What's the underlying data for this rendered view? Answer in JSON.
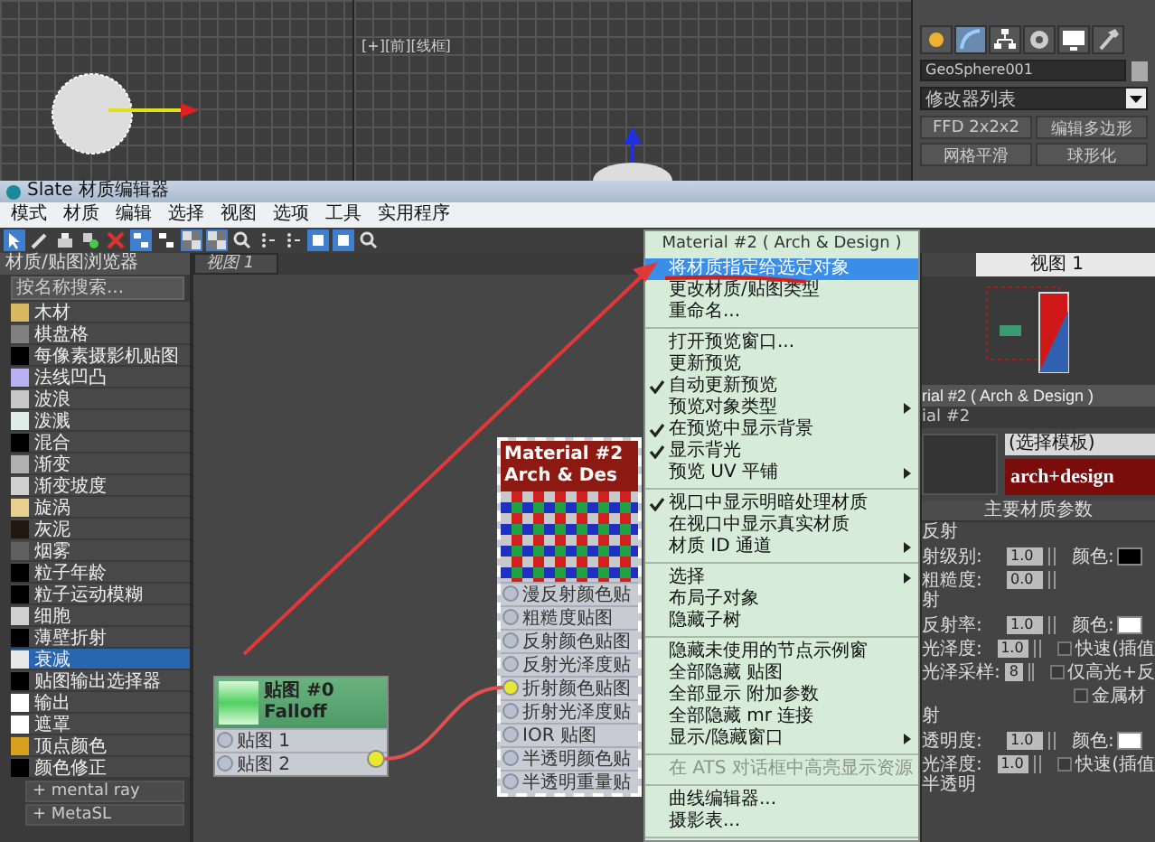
{
  "viewport": {
    "label": "[+][前][线框]"
  },
  "command_panel": {
    "tabs": [
      {
        "kind": "sun",
        "selected": false
      },
      {
        "kind": "curve",
        "selected": true
      },
      {
        "kind": "hierarchy",
        "selected": false
      },
      {
        "kind": "disc",
        "selected": false
      },
      {
        "kind": "monitor",
        "selected": false
      },
      {
        "kind": "hammer",
        "selected": false
      }
    ],
    "object_name": "GeoSphere001",
    "modifier_list": "修改器列表",
    "buttons": [
      "FFD 2x2x2",
      "编辑多边形",
      "网格平滑",
      "球形化"
    ]
  },
  "editor": {
    "title": "Slate 材质编辑器",
    "menu": [
      "模式",
      "材质",
      "编辑",
      "选择",
      "视图",
      "选项",
      "工具",
      "实用程序"
    ],
    "toolbar": [
      {
        "kind": "arrow",
        "selected": true
      },
      {
        "kind": "pen",
        "selected": false
      },
      {
        "kind": "put",
        "selected": false
      },
      {
        "kind": "assign",
        "selected": false
      },
      {
        "kind": "delete",
        "selected": false
      },
      {
        "kind": "layout",
        "selected": true
      },
      {
        "kind": "layout",
        "selected": false
      },
      {
        "kind": "checker",
        "selected": true
      },
      {
        "kind": "checker",
        "selected": true
      },
      {
        "kind": "zoom",
        "selected": false
      },
      {
        "kind": "dots",
        "selected": false
      },
      {
        "kind": "dots",
        "selected": false
      },
      {
        "kind": "square",
        "selected": true
      },
      {
        "kind": "square",
        "selected": true
      },
      {
        "kind": "zoom",
        "selected": false
      }
    ]
  },
  "browser": {
    "title": "材质/贴图浏览器",
    "placeholder": "按名称搜索...",
    "items": [
      {
        "label": "木材",
        "color": "#d8b860",
        "selected": false
      },
      {
        "label": "棋盘格",
        "color": "#808080",
        "selected": false
      },
      {
        "label": "每像素摄影机贴图",
        "color": "#000000",
        "selected": false
      },
      {
        "label": "法线凹凸",
        "color": "#b8b0f0",
        "selected": false
      },
      {
        "label": "波浪",
        "color": "#c8c8c8",
        "selected": false
      },
      {
        "label": "泼溅",
        "color": "#e0ece8",
        "selected": false
      },
      {
        "label": "混合",
        "color": "#000000",
        "selected": false
      },
      {
        "label": "渐变",
        "color": "#b0b0b0",
        "selected": false
      },
      {
        "label": "渐变坡度",
        "color": "#d0d0d0",
        "selected": false
      },
      {
        "label": "旋涡",
        "color": "#e8d090",
        "selected": false
      },
      {
        "label": "灰泥",
        "color": "#201810",
        "selected": false
      },
      {
        "label": "烟雾",
        "color": "#606060",
        "selected": false
      },
      {
        "label": "粒子年龄",
        "color": "#000000",
        "selected": false
      },
      {
        "label": "粒子运动模糊",
        "color": "#000000",
        "selected": false
      },
      {
        "label": "细胞",
        "color": "#d0d0d0",
        "selected": false
      },
      {
        "label": "薄壁折射",
        "color": "#000000",
        "selected": false
      },
      {
        "label": "衰减",
        "color": "#e8e8e8",
        "selected": true
      },
      {
        "label": "贴图输出选择器",
        "color": "#000000",
        "selected": false
      },
      {
        "label": "输出",
        "color": "#ffffff",
        "selected": false
      },
      {
        "label": "遮罩",
        "color": "#ffffff",
        "selected": false
      },
      {
        "label": "顶点颜色",
        "color": "#d8a020",
        "selected": false
      },
      {
        "label": "颜色修正",
        "color": "#000000",
        "selected": false
      }
    ],
    "groups": [
      "+ mental ray",
      "+ MetaSL"
    ]
  },
  "view_tab": "视图 1",
  "nodes": [
    {
      "kind": "map",
      "title": "贴图 #0",
      "subtitle": "Falloff",
      "selected": false,
      "slots": [
        {
          "label": "贴图 1",
          "connected": false
        },
        {
          "label": "贴图 2",
          "connected": false
        }
      ]
    },
    {
      "kind": "material",
      "title": "Material #2",
      "subtitle": "Arch & Des",
      "selected": true,
      "slots": [
        {
          "label": "漫反射颜色贴",
          "connected": false
        },
        {
          "label": "粗糙度贴图",
          "connected": false
        },
        {
          "label": "反射颜色贴图",
          "connected": false
        },
        {
          "label": "反射光泽度贴",
          "connected": false
        },
        {
          "label": "折射颜色贴图",
          "connected": true
        },
        {
          "label": "折射光泽度贴",
          "connected": false
        },
        {
          "label": "IOR 贴图",
          "connected": false
        },
        {
          "label": "半透明颜色贴",
          "connected": false
        },
        {
          "label": "半透明重量贴",
          "connected": false
        }
      ]
    }
  ],
  "context_menu": {
    "header": "Material #2 ( Arch & Design )",
    "groups": [
      [
        {
          "label": "将材质指定给选定对象",
          "checked": false,
          "submenu": false,
          "selected": true,
          "disabled": false
        },
        {
          "label": "更改材质/贴图类型",
          "checked": false,
          "submenu": false,
          "selected": false,
          "disabled": false
        },
        {
          "label": "重命名...",
          "checked": false,
          "submenu": false,
          "selected": false,
          "disabled": false
        }
      ],
      [
        {
          "label": "打开预览窗口...",
          "checked": false,
          "submenu": false,
          "selected": false,
          "disabled": false
        },
        {
          "label": "更新预览",
          "checked": false,
          "submenu": false,
          "selected": false,
          "disabled": false
        },
        {
          "label": "自动更新预览",
          "checked": true,
          "submenu": false,
          "selected": false,
          "disabled": false
        },
        {
          "label": "预览对象类型",
          "checked": false,
          "submenu": true,
          "selected": false,
          "disabled": false
        },
        {
          "label": "在预览中显示背景",
          "checked": true,
          "submenu": false,
          "selected": false,
          "disabled": false
        },
        {
          "label": "显示背光",
          "checked": true,
          "submenu": false,
          "selected": false,
          "disabled": false
        },
        {
          "label": "预览 UV 平铺",
          "checked": false,
          "submenu": true,
          "selected": false,
          "disabled": false
        }
      ],
      [
        {
          "label": "视口中显示明暗处理材质",
          "checked": true,
          "submenu": false,
          "selected": false,
          "disabled": false
        },
        {
          "label": "在视口中显示真实材质",
          "checked": false,
          "submenu": false,
          "selected": false,
          "disabled": false
        },
        {
          "label": "材质 ID 通道",
          "checked": false,
          "submenu": true,
          "selected": false,
          "disabled": false
        }
      ],
      [
        {
          "label": "选择",
          "checked": false,
          "submenu": true,
          "selected": false,
          "disabled": false
        },
        {
          "label": "布局子对象",
          "checked": false,
          "submenu": false,
          "selected": false,
          "disabled": false
        },
        {
          "label": "隐藏子树",
          "checked": false,
          "submenu": false,
          "selected": false,
          "disabled": false
        }
      ],
      [
        {
          "label": "隐藏未使用的节点示例窗",
          "checked": false,
          "submenu": false,
          "selected": false,
          "disabled": false
        },
        {
          "label": "全部隐藏 贴图",
          "checked": false,
          "submenu": false,
          "selected": false,
          "disabled": false
        },
        {
          "label": "全部显示 附加参数",
          "checked": false,
          "submenu": false,
          "selected": false,
          "disabled": false
        },
        {
          "label": "全部隐藏 mr 连接",
          "checked": false,
          "submenu": false,
          "selected": false,
          "disabled": false
        },
        {
          "label": "显示/隐藏窗口",
          "checked": false,
          "submenu": true,
          "selected": false,
          "disabled": false
        }
      ],
      [
        {
          "label": "在 ATS 对话框中高亮显示资源",
          "checked": false,
          "submenu": false,
          "selected": false,
          "disabled": true
        }
      ],
      [
        {
          "label": "曲线编辑器...",
          "checked": false,
          "submenu": false,
          "selected": false,
          "disabled": false
        },
        {
          "label": "摄影表...",
          "checked": false,
          "submenu": false,
          "selected": false,
          "disabled": false
        }
      ]
    ]
  },
  "material_panel": {
    "view_select": "视图 1",
    "title": "rial #2 ( Arch & Design )",
    "name": "ial #2",
    "template": "(选择模板)",
    "logo": "arch+design",
    "rollout": "主要材质参数",
    "sections": [
      {
        "title": "反射",
        "rows": [
          {
            "label": "射级别:",
            "value": "1.0",
            "extra": {
              "kind": "color",
              "label": "颜色:",
              "color": "#000000"
            }
          },
          {
            "label": "粗糙度:",
            "value": "0.0"
          }
        ]
      },
      {
        "title": "射",
        "rows": [
          {
            "label": "反射率:",
            "value": "1.0",
            "extra": {
              "kind": "color",
              "label": "颜色:",
              "color": "#ffffff"
            }
          },
          {
            "label": "光泽度:",
            "value": "1.0",
            "extra": {
              "kind": "check",
              "label": "快速(插值",
              "checked": false
            }
          },
          {
            "label": "光泽采样:",
            "value": "8",
            "extra": {
              "kind": "check",
              "label": "仅高光+反",
              "checked": false
            }
          },
          {
            "extra": {
              "kind": "check",
              "label": "金属材",
              "checked": false
            }
          }
        ]
      },
      {
        "title": "射",
        "rows": [
          {
            "label": "透明度:",
            "value": "1.0",
            "extra": {
              "kind": "color",
              "label": "颜色:",
              "color": "#ffffff"
            }
          },
          {
            "label": "光泽度:",
            "value": "1.0",
            "extra": {
              "kind": "check",
              "label": "快速(插值",
              "checked": false
            }
          }
        ]
      },
      {
        "title": "半透明"
      }
    ]
  }
}
